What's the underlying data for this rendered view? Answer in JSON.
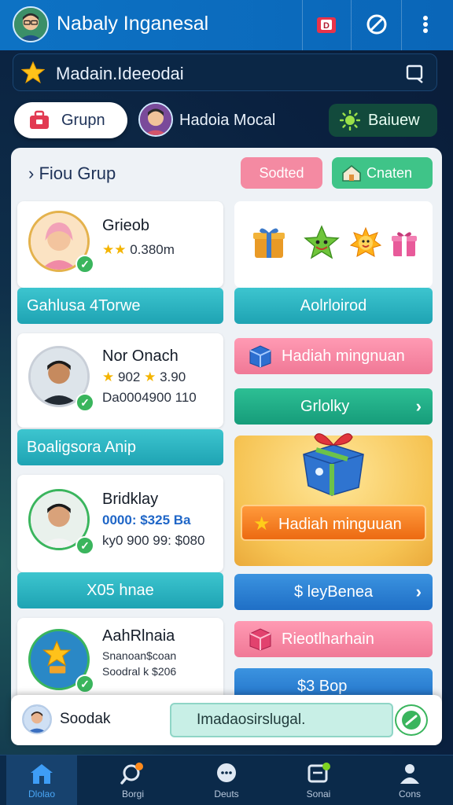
{
  "appbar": {
    "title": "Nabaly Inganesal",
    "avatar_icon": "user-avatar-icon",
    "actions": [
      "gift-icon",
      "block-icon",
      "more-vert-icon"
    ]
  },
  "strip": {
    "label": "Madain.Ideeodai",
    "left_icon": "star-icon",
    "right_icon": "message-icon"
  },
  "pills": {
    "grupn": "Grupn",
    "user_chip": "Hadoia Mocal",
    "baiuew": "Baiuew"
  },
  "panel": {
    "title": "› Fiou Grup",
    "sodted": "Sodted",
    "cnaten": "Cnaten"
  },
  "cards": [
    {
      "name": "Grieob",
      "meta1": "0.380m",
      "meta2": "",
      "button": "Gahlusa 4Torwe"
    },
    {
      "name": "Nor Onach",
      "meta1": "902",
      "meta1b": "3.90",
      "meta2": "Da0004900 110",
      "button": "Boaligsora Anip"
    },
    {
      "name": "Bridklay",
      "meta1": "0000: $325 Ba",
      "meta2": "ky0 900 99: $080",
      "button": "X05 hnae"
    },
    {
      "name": "AahRlnaia",
      "meta1": "Snanoan$coan",
      "meta2": "Soodral k $206",
      "button": ""
    }
  ],
  "right": {
    "gift_row_button": "Aolrloirod",
    "hadiah1": "Hadiah mingnuan",
    "btn_green": "Grlolky",
    "promo_button": "Hadiah minguuan",
    "btn_blue": "$ leyBenea",
    "btn_pink": "Rieotlharhain",
    "btn_blue2": "$3 Bop"
  },
  "chatbar": {
    "who": "Soodak",
    "input_value": "Imadaosirslugal.",
    "send_icon": "check-send-icon"
  },
  "nav": [
    {
      "label": "Dlolao",
      "icon": "home-icon",
      "active": true
    },
    {
      "label": "Borgi",
      "icon": "search-icon",
      "active": false
    },
    {
      "label": "Deuts",
      "icon": "chat-bubble-icon",
      "active": false
    },
    {
      "label": "Sonai",
      "icon": "inbox-icon",
      "active": false
    },
    {
      "label": "Cons",
      "icon": "profile-icon",
      "active": false
    }
  ],
  "colors": {
    "appbar": "#0d72c4",
    "teal_button": "#1ea3b3",
    "pink_button": "#f48aa2",
    "green_button": "#3fc488",
    "promo_orange": "#f07a1e"
  }
}
